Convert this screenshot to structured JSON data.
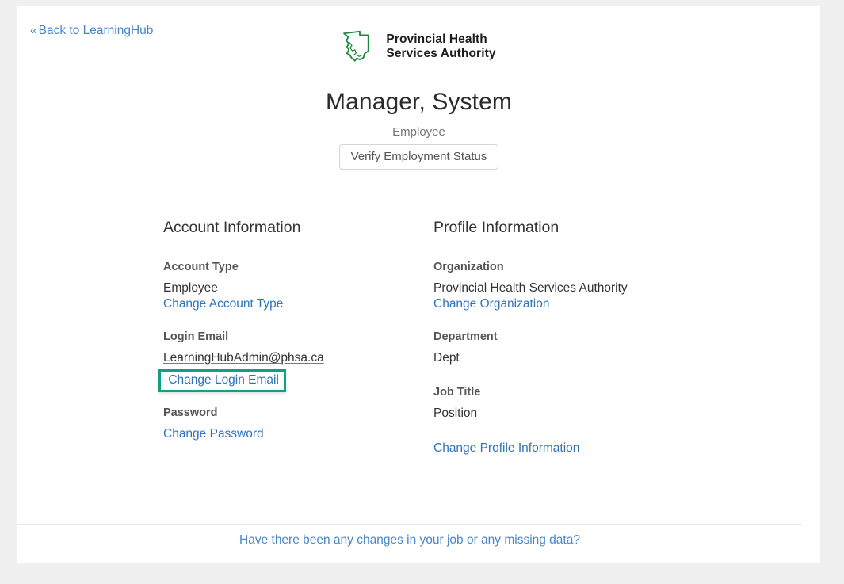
{
  "nav": {
    "back_link": "Back to LearningHub",
    "back_chevron": "«"
  },
  "branding": {
    "logo_icon": "bc-map-outline-icon",
    "logo_line1": "Provincial Health",
    "logo_line2": "Services Authority",
    "logo_color": "#1f8a3b"
  },
  "header": {
    "user_name": "Manager, System",
    "account_type_subtitle": "Employee",
    "verify_button_label": "Verify Employment Status"
  },
  "account_information": {
    "heading": "Account Information",
    "account_type_label": "Account Type",
    "account_type_value": "Employee",
    "change_account_type_link": "Change Account Type",
    "login_email_label": "Login Email",
    "login_email_value": "LearningHubAdmin@phsa.ca",
    "change_login_email_link": "Change Login Email",
    "password_label": "Password",
    "change_password_link": "Change Password"
  },
  "profile_information": {
    "heading": "Profile Information",
    "organization_label": "Organization",
    "organization_value": "Provincial Health Services Authority",
    "change_organization_link": "Change Organization",
    "department_label": "Department",
    "department_value": "Dept",
    "job_title_label": "Job Title",
    "job_title_value": "Position",
    "change_profile_information_link": "Change Profile Information"
  },
  "footer": {
    "question_link": "Have there been any changes in your job or any missing data?"
  },
  "colors": {
    "link_blue": "#2d74bc",
    "nav_blue": "#4a86c8",
    "highlight_teal": "#12a085",
    "page_background": "#f0f0f0",
    "card_background": "#ffffff"
  }
}
